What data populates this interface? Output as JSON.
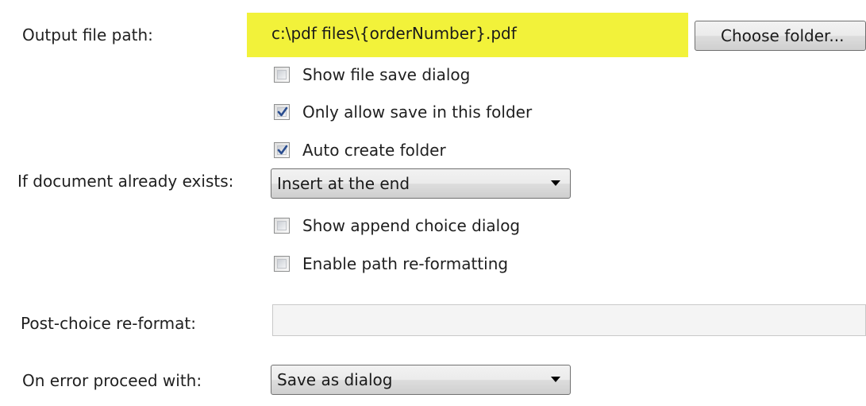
{
  "output_path": {
    "label": "Output file path:",
    "value": "c:\\pdf files\\{orderNumber}.pdf",
    "highlight_color": "#f2f23a"
  },
  "choose_folder": {
    "label": "Choose folder..."
  },
  "options": {
    "show_file_save_dialog": {
      "label": "Show file save dialog",
      "checked": false
    },
    "only_allow_save": {
      "label": "Only allow save in this folder",
      "checked": true
    },
    "auto_create_folder": {
      "label": "Auto create folder",
      "checked": true
    },
    "show_append_choice": {
      "label": "Show append choice dialog",
      "checked": false
    },
    "enable_path_reformat": {
      "label": "Enable path re-formatting",
      "checked": false
    }
  },
  "if_exists": {
    "label": "If document already exists:",
    "selected": "Insert at the end"
  },
  "post_choice": {
    "label": "Post-choice re-format:",
    "value": ""
  },
  "on_error": {
    "label": "On error proceed with:",
    "selected": "Save as dialog"
  },
  "icons": {
    "check": "checkmark-icon",
    "dropdown": "dropdown-arrow-icon"
  },
  "colors": {
    "checkmark": "#2a4d8f"
  }
}
